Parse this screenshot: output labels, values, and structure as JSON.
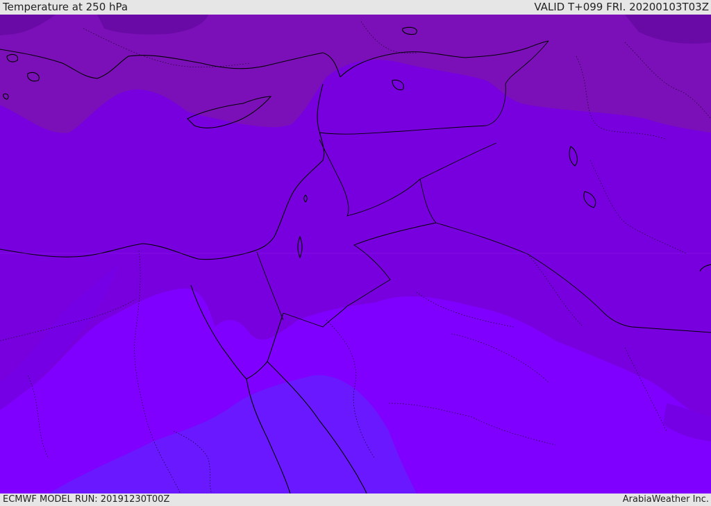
{
  "header": {
    "title": "Temperature at 250 hPa",
    "valid_time": "VALID T+099 FRI. 20200103T03Z"
  },
  "footer": {
    "model_run": "ECMWF MODEL RUN: 20191230T00Z",
    "credit": "ArabiaWeather Inc."
  },
  "map": {
    "field": "temperature",
    "level": "250 hPa",
    "colors": {
      "coldest": "#6a0aa6",
      "cold": "#7b10b8",
      "mid": "#7800df",
      "warm": "#8000ff",
      "warmest": "#6918ff"
    }
  }
}
